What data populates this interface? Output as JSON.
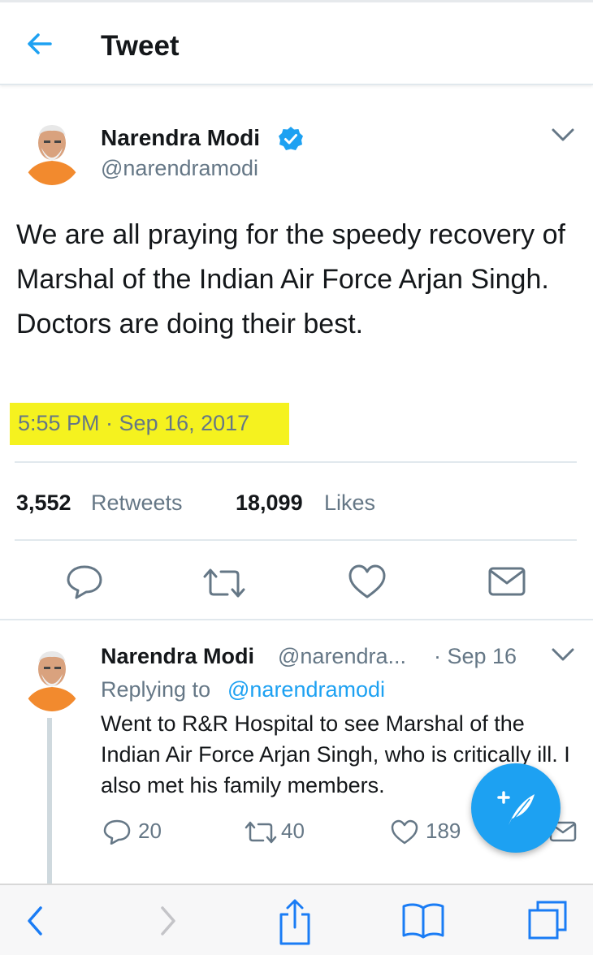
{
  "header": {
    "title": "Tweet",
    "back_icon": "arrow-left-icon"
  },
  "tweet": {
    "author_name": "Narendra Modi",
    "author_handle": "@narendramodi",
    "verified_icon": "verified-badge-icon",
    "text": "We are all praying for the speedy recovery of Marshal of the Indian Air Force Arjan Singh. Doctors are doing their best.",
    "timestamp": "5:55 PM · Sep 16, 2017",
    "retweets_count": "3,552",
    "retweets_label": "Retweets",
    "likes_count": "18,099",
    "likes_label": "Likes",
    "highlight_color": "#f5f21f",
    "actions": [
      "reply-icon",
      "retweet-icon",
      "like-icon",
      "share-mail-icon"
    ]
  },
  "reply": {
    "author_name": "Narendra Modi",
    "author_handle": "@narendra...",
    "date": "· Sep 16",
    "replying_prefix": "Replying to",
    "replying_to": "@narendramodi",
    "text": "Went to R&R Hospital to see Marshal of the Indian Air Force Arjan Singh, who is critically ill. I also met his family members.",
    "reply_count": "20",
    "retweet_count": "40",
    "like_count": "189"
  },
  "colors": {
    "accent": "#1da1f2",
    "secondary_text": "#657786",
    "border": "#e1e8ed"
  },
  "browser_bar": [
    "back-icon",
    "forward-icon",
    "share-icon",
    "bookmarks-icon",
    "tabs-icon"
  ]
}
